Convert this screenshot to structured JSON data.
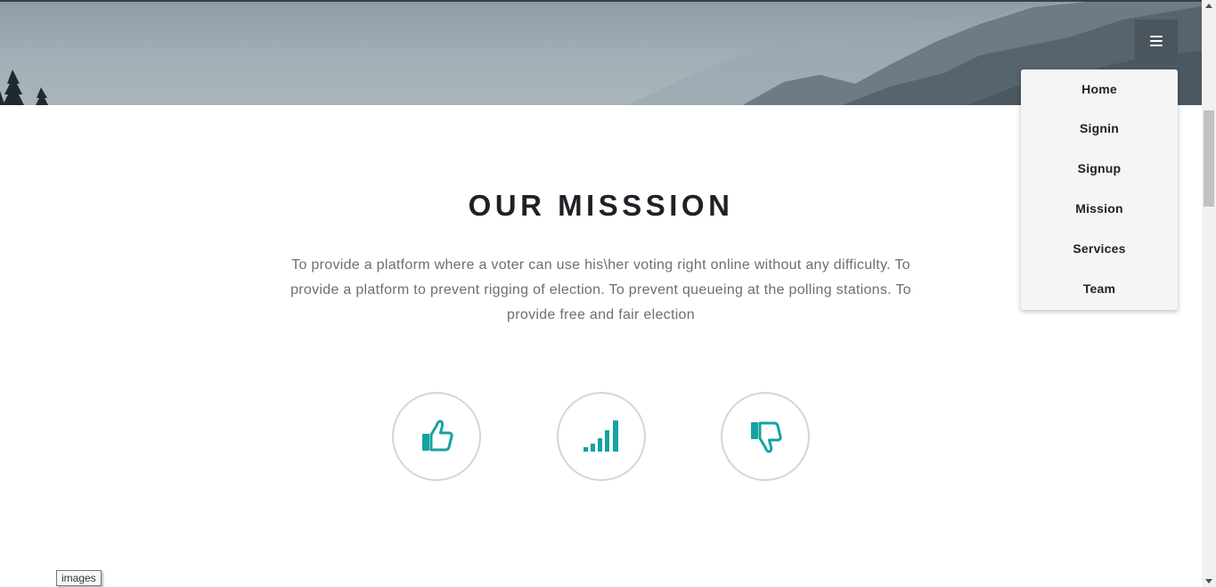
{
  "nav": {
    "toggle_icon": "hamburger-icon",
    "items": [
      {
        "label": "Home"
      },
      {
        "label": "Signin"
      },
      {
        "label": "Signup"
      },
      {
        "label": "Mission"
      },
      {
        "label": "Services"
      },
      {
        "label": "Team"
      }
    ]
  },
  "mission": {
    "title": "OUR MISSSION",
    "text": "To provide a platform where a voter can use his\\her voting right online without any difficulty. To provide a platform to prevent rigging of election. To prevent queueing at the polling stations. To provide free and fair election"
  },
  "features": [
    {
      "icon": "thumbs-up-icon"
    },
    {
      "icon": "signal-bars-icon"
    },
    {
      "icon": "thumbs-down-icon"
    }
  ],
  "tooltip": {
    "text": "images"
  },
  "colors": {
    "accent": "#17a2a2",
    "title": "#1e2226",
    "body_text": "#6a6f75",
    "menu_bg": "#f5f5f5",
    "toggle_bg": "#4a555d"
  }
}
